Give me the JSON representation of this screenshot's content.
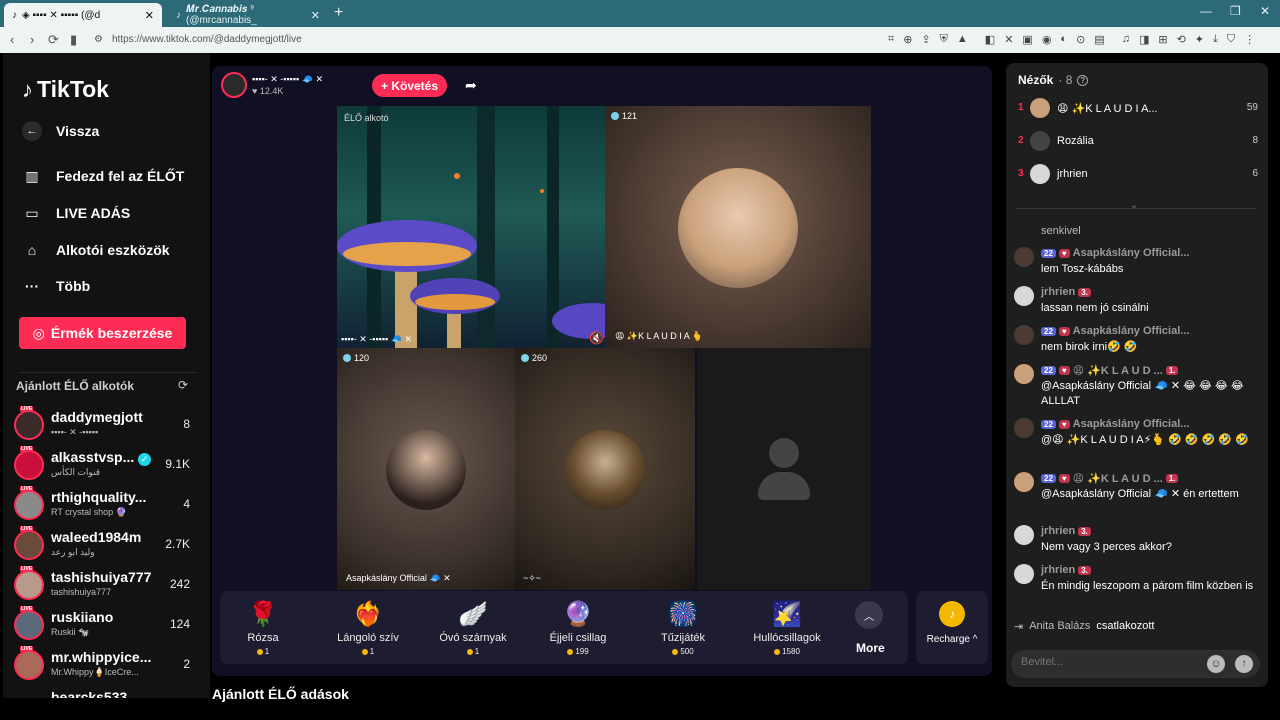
{
  "browser": {
    "tab1_title": "◈ ▪▪▪▪ ✕ ▪▪▪▪▪ (@d",
    "tab2_title": "𝑴𝒓.𝑪𝒂𝒏𝒏𝒂𝒃𝒊𝒔 ⁹ (@mrcannabis_",
    "url": "https://www.tiktok.com/@daddymegjott/live"
  },
  "sidebar": {
    "logo": "TikTok",
    "back": "Vissza",
    "items": [
      "Fedezd fel az ÉLŐT",
      "LIVE ADÁS",
      "Alkotói eszközök",
      "Több"
    ],
    "coin_button": "Érmék beszerzése",
    "recommended_title": "Ajánlott ÉLŐ alkotók",
    "accounts": [
      {
        "name": "daddymegjott",
        "sub": "▪▪▪▪- ✕ -▪▪▪▪▪",
        "count": "8"
      },
      {
        "name": "alkasstvsp...",
        "sub": "قنوات الكأس",
        "count": "9.1K"
      },
      {
        "name": "rthighquality...",
        "sub": "RT crystal shop 🔮",
        "count": "4"
      },
      {
        "name": "waleed1984m",
        "sub": "وليد ابو رعد",
        "count": "2.7K"
      },
      {
        "name": "tashishuiya777",
        "sub": "tashishuiya777",
        "count": "242"
      },
      {
        "name": "ruskiiano",
        "sub": "Ruskii 🐄",
        "count": "124"
      },
      {
        "name": "mr.whippyice...",
        "sub": "Mr.Whippy🍦IceCre...",
        "count": "2"
      },
      {
        "name": "bearcks533",
        "sub": "",
        "count": ""
      }
    ],
    "live_badge": "LIVE"
  },
  "stream": {
    "host_name": "▪▪▪▪- ✕ -▪▪▪▪▪ 🧢 ✕",
    "likes": "12.4K",
    "follow": "+ Követés",
    "host_label": "ÉLŐ alkotó",
    "cells": [
      {
        "count": "121",
        "caption": "😩 ✨K L A U D I A 🫰"
      },
      {
        "count": "120",
        "caption": "Asapkáslány Official 🧢 ✕"
      },
      {
        "count": "260",
        "caption": "~✧~"
      }
    ],
    "host_caption": "▪▪▪▪- ✕ -▪▪▪▪▪ 🧢 ✕"
  },
  "gifts": [
    {
      "name": "Rózsa",
      "price": "1",
      "icon": "🌹"
    },
    {
      "name": "Lángoló szív",
      "price": "1",
      "icon": "❤️‍🔥"
    },
    {
      "name": "Óvó szárnyak",
      "price": "1",
      "icon": "🪽"
    },
    {
      "name": "Éjjeli csillag",
      "price": "199",
      "icon": "🔮"
    },
    {
      "name": "Tűzijáték",
      "price": "500",
      "icon": "🎆"
    },
    {
      "name": "Hullócsillagok",
      "price": "1580",
      "icon": "🌠"
    }
  ],
  "more": "More",
  "recharge": "Recharge ^",
  "bottom_title": "Ajánlott ÉLŐ adások",
  "viewers": {
    "title": "Nézők",
    "count": "8",
    "list": [
      {
        "rank": "1",
        "name": "😩 ✨K L A U D I A...",
        "score": "59"
      },
      {
        "rank": "2",
        "name": "Rozália",
        "score": "8"
      },
      {
        "rank": "3",
        "name": "jrhrien",
        "score": "6"
      }
    ]
  },
  "chat": {
    "partial": "senkivel",
    "messages": [
      {
        "user": "Asapkáslány Official...",
        "lvl": "22",
        "fan": "",
        "text": "lem Tosz-kábábs"
      },
      {
        "user": "jrhrien",
        "lvl": "",
        "fan": "3.",
        "text": "lassan nem jó csinálni"
      },
      {
        "user": "Asapkáslány Official...",
        "lvl": "22",
        "fan": "",
        "text": "nem birok irni🤣 🤣"
      },
      {
        "user": "😩 ✨K L A U D ...",
        "lvl": "22",
        "fan": "1.",
        "text": "@Asapkáslány Official 🧢 ✕ 😂 😂 😂 😂 ALLLAT"
      },
      {
        "user": "Asapkáslány Official...",
        "lvl": "22",
        "fan": "",
        "text": "@😩 ✨K L A U D I A⚡🫰 🤣 🤣 🤣 🤣 🤣"
      },
      {
        "user": "😩 ✨K L A U D ...",
        "lvl": "22",
        "fan": "1.",
        "text": "@Asapkáslány Official 🧢 ✕ én ertettem"
      },
      {
        "user": "jrhrien",
        "lvl": "",
        "fan": "3.",
        "text": "Nem vagy 3 perces akkor?"
      },
      {
        "user": "jrhrien",
        "lvl": "",
        "fan": "3.",
        "text": "Én mindig leszopom a párom film közben is"
      }
    ],
    "join_user": "Anita Balázs",
    "join_text": "csatlakozott",
    "input_placeholder": "Bevitel..."
  }
}
